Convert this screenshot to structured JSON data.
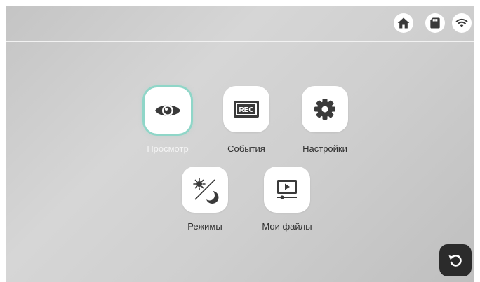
{
  "status_bar": {
    "icons": [
      "home-icon",
      "sd-card-icon",
      "wifi-icon"
    ]
  },
  "menu": {
    "items": [
      {
        "id": "view",
        "label": "Просмотр",
        "icon": "eye-icon",
        "active": true
      },
      {
        "id": "events",
        "label": "События",
        "icon": "rec-icon",
        "active": false
      },
      {
        "id": "settings",
        "label": "Настройки",
        "icon": "gear-icon",
        "active": false
      },
      {
        "id": "modes",
        "label": "Режимы",
        "icon": "day-night-icon",
        "active": false
      },
      {
        "id": "files",
        "label": "Мои файлы",
        "icon": "media-files-icon",
        "active": false
      }
    ]
  },
  "back_button": {
    "icon": "back-arrow-icon"
  },
  "colors": {
    "accent": "#8fd6c8",
    "icon_dark": "#3a3a3a",
    "back_bg": "#2b2b2b"
  }
}
